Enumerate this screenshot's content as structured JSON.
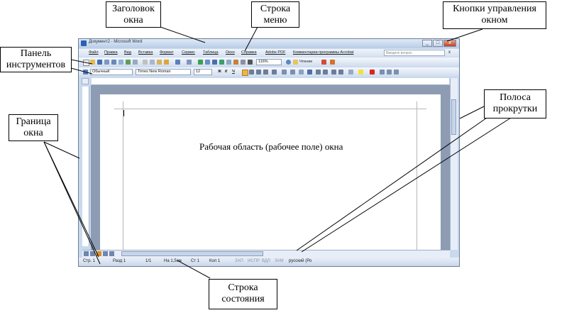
{
  "window": {
    "title": "Документ2 - Microsoft Word",
    "controls": [
      "_",
      "□",
      "x"
    ]
  },
  "menu": {
    "items": [
      "Файл",
      "Правка",
      "Вид",
      "Вставка",
      "Формат",
      "Сервис",
      "Таблица",
      "Окно",
      "Справка",
      "Adobe PDF",
      "Комментарии программы Acrobat"
    ],
    "help_placeholder": "Введите вопрос",
    "close": "x"
  },
  "toolbar": {
    "zoom": "116%",
    "read_button": "Чтение",
    "style": "Обычный",
    "font": "Times New Roman",
    "size": "12",
    "bold": "Ж",
    "italic": "К",
    "underline": "Ч"
  },
  "page": {
    "work_area_label": "Рабочая область (рабочее поле) окна"
  },
  "status": {
    "page": "Стр. 1",
    "section": "Разд 1",
    "pages": "1/1",
    "at": "На 1,5см",
    "line": "Ст 1",
    "col": "Кол 1",
    "rec": "ЗАП",
    "trk": "ИСПР",
    "ext": "ВДЛ",
    "ovr": "ЗАМ",
    "language": "русский (Ро"
  },
  "callouts": {
    "title_bar": "Заголовок окна",
    "menu_bar": "Строка меню",
    "window_controls": "Кнопки управления окном",
    "toolbars": "Панель инструментов",
    "border": "Граница окна",
    "scrollbar": "Полоса прокрутки",
    "status_bar": "Строка состояния"
  }
}
